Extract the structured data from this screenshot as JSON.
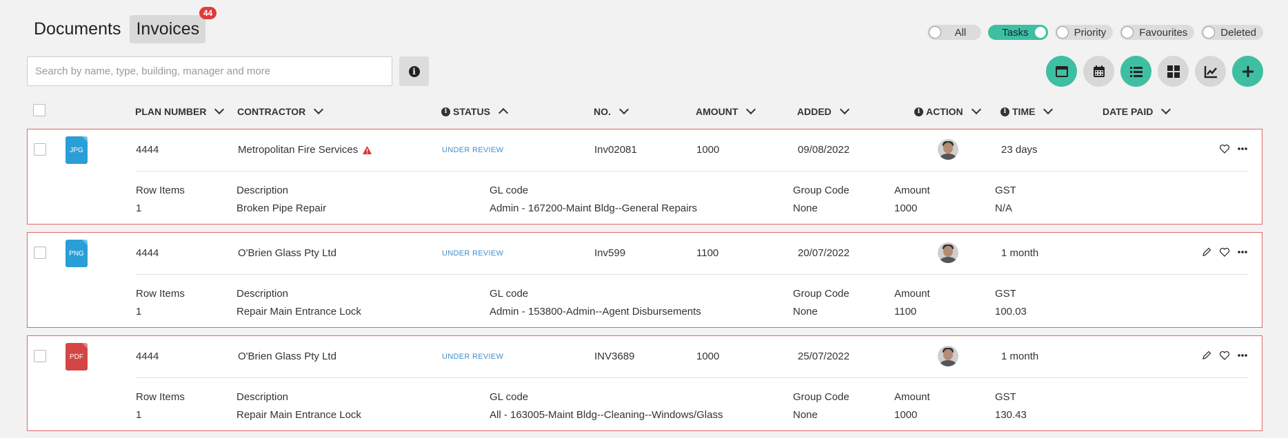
{
  "tabs": [
    {
      "label": "Documents"
    },
    {
      "label": "Invoices",
      "badge": "44"
    }
  ],
  "filters": [
    {
      "label": "All",
      "on": false
    },
    {
      "label": "Tasks",
      "on": true
    },
    {
      "label": "Priority",
      "on": false
    },
    {
      "label": "Favourites",
      "on": false
    },
    {
      "label": "Deleted",
      "on": false
    }
  ],
  "search": {
    "placeholder": "Search by name, type, building, manager and more",
    "value": ""
  },
  "info_button": {
    "glyph": "i"
  },
  "toolbar_icons": [
    "table-view-icon",
    "calendar-icon",
    "list-view-icon",
    "grid-view-icon",
    "chart-icon",
    "add-icon"
  ],
  "columns": {
    "plan_number": "PLAN NUMBER",
    "contractor": "CONTRACTOR",
    "status": "STATUS",
    "no": "NO.",
    "amount": "AMOUNT",
    "added": "ADDED",
    "action": "ACTION",
    "time": "TIME",
    "date_paid": "DATE PAID"
  },
  "detail_headers": {
    "row_items": "Row Items",
    "description": "Description",
    "gl_code": "GL code",
    "group_code": "Group Code",
    "amount": "Amount",
    "gst": "GST"
  },
  "colors": {
    "accent": "#3fbfa2",
    "error": "#e03b3b",
    "status": "#3f8fcf"
  },
  "rows": [
    {
      "file_type": "JPG",
      "file_color": "blue",
      "plan_number": "4444",
      "contractor": "Metropolitan Fire Services",
      "warning": true,
      "status": "UNDER REVIEW",
      "no": "Inv02081",
      "amount": "1000",
      "added": "09/08/2022",
      "time": "23 days",
      "editable": false,
      "detail": {
        "row_items": "1",
        "description": "Broken Pipe Repair",
        "gl_code": "Admin - 167200-Maint Bldg--General Repairs",
        "group_code": "None",
        "amount": "1000",
        "gst": "N/A"
      }
    },
    {
      "file_type": "PNG",
      "file_color": "blue",
      "plan_number": "4444",
      "contractor": "O'Brien Glass Pty Ltd",
      "warning": false,
      "status": "UNDER REVIEW",
      "no": "Inv599",
      "amount": "1100",
      "added": "20/07/2022",
      "time": "1 month",
      "editable": true,
      "detail": {
        "row_items": "1",
        "description": "Repair Main Entrance Lock",
        "gl_code": "Admin - 153800-Admin--Agent Disbursements",
        "group_code": "None",
        "amount": "1100",
        "gst": "100.03"
      }
    },
    {
      "file_type": "PDF",
      "file_color": "red",
      "plan_number": "4444",
      "contractor": "O'Brien Glass Pty Ltd",
      "warning": false,
      "status": "UNDER REVIEW",
      "no": "INV3689",
      "amount": "1000",
      "added": "25/07/2022",
      "time": "1 month",
      "editable": true,
      "detail": {
        "row_items": "1",
        "description": "Repair Main Entrance Lock",
        "gl_code": "All - 163005-Maint Bldg--Cleaning--Windows/Glass",
        "group_code": "None",
        "amount": "1000",
        "gst": "130.43"
      }
    }
  ]
}
